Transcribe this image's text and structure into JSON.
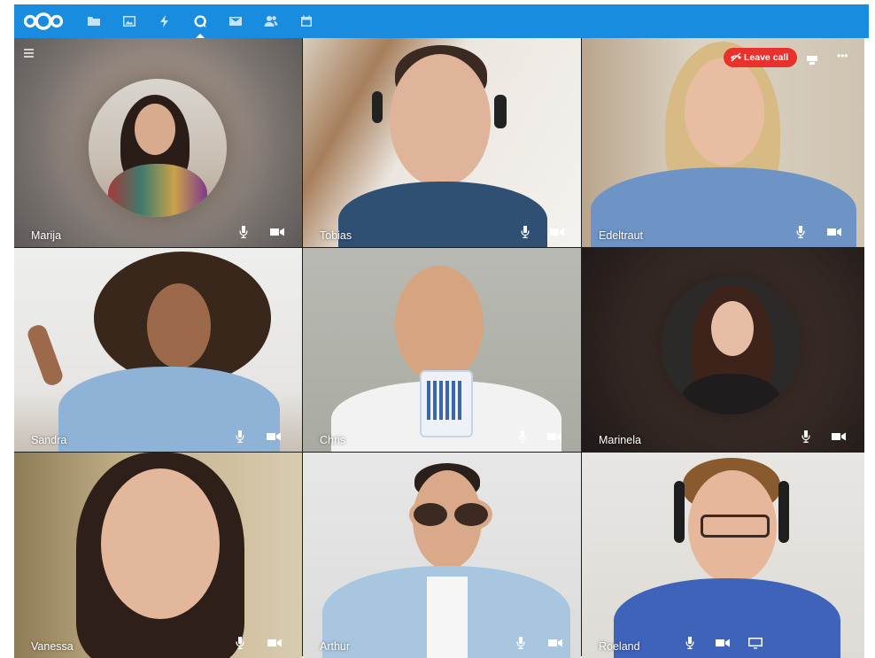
{
  "apps": [
    {
      "name": "files",
      "icon": "folder-icon"
    },
    {
      "name": "photos",
      "icon": "image-icon"
    },
    {
      "name": "activity",
      "icon": "lightning-icon"
    },
    {
      "name": "talk",
      "icon": "talk-icon",
      "active": true
    },
    {
      "name": "mail",
      "icon": "mail-icon"
    },
    {
      "name": "contacts",
      "icon": "contacts-icon"
    },
    {
      "name": "calendar",
      "icon": "calendar-icon"
    }
  ],
  "call": {
    "leave_label": "Leave call"
  },
  "participants": [
    {
      "name": "Marija",
      "display": "avatar"
    },
    {
      "name": "Tobias",
      "display": "video"
    },
    {
      "name": "Edeltraut",
      "display": "video"
    },
    {
      "name": "Sandra",
      "display": "video"
    },
    {
      "name": "Chris",
      "display": "video"
    },
    {
      "name": "Marinela",
      "display": "avatar"
    },
    {
      "name": "Vanessa",
      "display": "video"
    },
    {
      "name": "Arthur",
      "display": "video"
    },
    {
      "name": "Roeland",
      "display": "video"
    }
  ],
  "colors": {
    "header": "#1a8ce0",
    "leave_call": "#e9322d"
  }
}
